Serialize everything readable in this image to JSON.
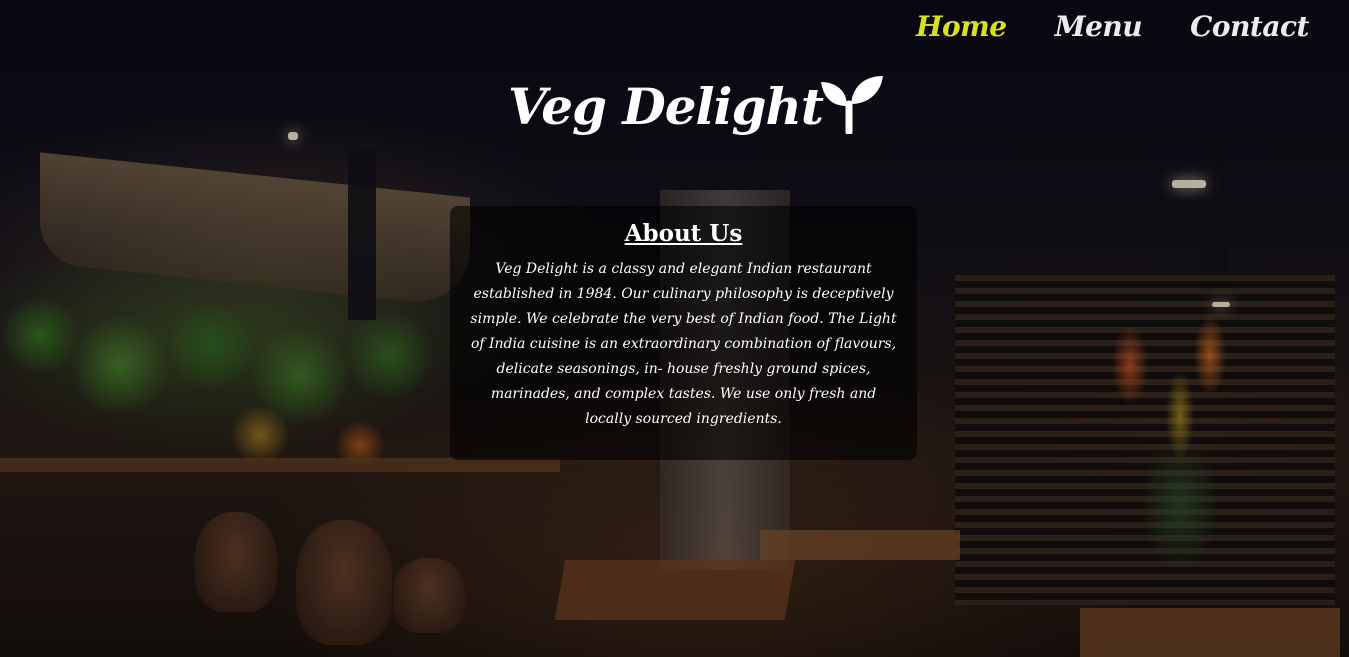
{
  "nav": {
    "items": [
      {
        "label": "Home",
        "active": true
      },
      {
        "label": "Menu",
        "active": false
      },
      {
        "label": "Contact",
        "active": false
      }
    ],
    "active_color": "#d9e021",
    "color": "#ececec"
  },
  "logo": {
    "text": "Veg Delight",
    "icon": "leaf-sprout-icon"
  },
  "about": {
    "title": "About Us",
    "body": "Veg Delight is a classy and elegant Indian restaurant established in 1984. Our culinary philosophy is deceptively simple. We celebrate the very best of Indian food. The Light of India cuisine is an extraordinary combination of flavours, delicate seasonings, in- house freshly ground spices, marinades, and complex tastes. We use only fresh and locally sourced ingredients."
  }
}
